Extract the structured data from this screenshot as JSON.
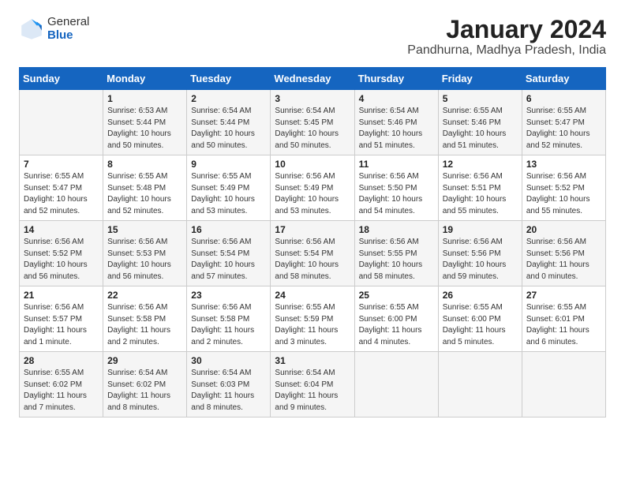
{
  "logo": {
    "general": "General",
    "blue": "Blue"
  },
  "title": "January 2024",
  "location": "Pandhurna, Madhya Pradesh, India",
  "days_header": [
    "Sunday",
    "Monday",
    "Tuesday",
    "Wednesday",
    "Thursday",
    "Friday",
    "Saturday"
  ],
  "weeks": [
    [
      {
        "day": "",
        "info": ""
      },
      {
        "day": "1",
        "info": "Sunrise: 6:53 AM\nSunset: 5:44 PM\nDaylight: 10 hours\nand 50 minutes."
      },
      {
        "day": "2",
        "info": "Sunrise: 6:54 AM\nSunset: 5:44 PM\nDaylight: 10 hours\nand 50 minutes."
      },
      {
        "day": "3",
        "info": "Sunrise: 6:54 AM\nSunset: 5:45 PM\nDaylight: 10 hours\nand 50 minutes."
      },
      {
        "day": "4",
        "info": "Sunrise: 6:54 AM\nSunset: 5:46 PM\nDaylight: 10 hours\nand 51 minutes."
      },
      {
        "day": "5",
        "info": "Sunrise: 6:55 AM\nSunset: 5:46 PM\nDaylight: 10 hours\nand 51 minutes."
      },
      {
        "day": "6",
        "info": "Sunrise: 6:55 AM\nSunset: 5:47 PM\nDaylight: 10 hours\nand 52 minutes."
      }
    ],
    [
      {
        "day": "7",
        "info": "Sunrise: 6:55 AM\nSunset: 5:47 PM\nDaylight: 10 hours\nand 52 minutes."
      },
      {
        "day": "8",
        "info": "Sunrise: 6:55 AM\nSunset: 5:48 PM\nDaylight: 10 hours\nand 52 minutes."
      },
      {
        "day": "9",
        "info": "Sunrise: 6:55 AM\nSunset: 5:49 PM\nDaylight: 10 hours\nand 53 minutes."
      },
      {
        "day": "10",
        "info": "Sunrise: 6:56 AM\nSunset: 5:49 PM\nDaylight: 10 hours\nand 53 minutes."
      },
      {
        "day": "11",
        "info": "Sunrise: 6:56 AM\nSunset: 5:50 PM\nDaylight: 10 hours\nand 54 minutes."
      },
      {
        "day": "12",
        "info": "Sunrise: 6:56 AM\nSunset: 5:51 PM\nDaylight: 10 hours\nand 55 minutes."
      },
      {
        "day": "13",
        "info": "Sunrise: 6:56 AM\nSunset: 5:52 PM\nDaylight: 10 hours\nand 55 minutes."
      }
    ],
    [
      {
        "day": "14",
        "info": "Sunrise: 6:56 AM\nSunset: 5:52 PM\nDaylight: 10 hours\nand 56 minutes."
      },
      {
        "day": "15",
        "info": "Sunrise: 6:56 AM\nSunset: 5:53 PM\nDaylight: 10 hours\nand 56 minutes."
      },
      {
        "day": "16",
        "info": "Sunrise: 6:56 AM\nSunset: 5:54 PM\nDaylight: 10 hours\nand 57 minutes."
      },
      {
        "day": "17",
        "info": "Sunrise: 6:56 AM\nSunset: 5:54 PM\nDaylight: 10 hours\nand 58 minutes."
      },
      {
        "day": "18",
        "info": "Sunrise: 6:56 AM\nSunset: 5:55 PM\nDaylight: 10 hours\nand 58 minutes."
      },
      {
        "day": "19",
        "info": "Sunrise: 6:56 AM\nSunset: 5:56 PM\nDaylight: 10 hours\nand 59 minutes."
      },
      {
        "day": "20",
        "info": "Sunrise: 6:56 AM\nSunset: 5:56 PM\nDaylight: 11 hours\nand 0 minutes."
      }
    ],
    [
      {
        "day": "21",
        "info": "Sunrise: 6:56 AM\nSunset: 5:57 PM\nDaylight: 11 hours\nand 1 minute."
      },
      {
        "day": "22",
        "info": "Sunrise: 6:56 AM\nSunset: 5:58 PM\nDaylight: 11 hours\nand 2 minutes."
      },
      {
        "day": "23",
        "info": "Sunrise: 6:56 AM\nSunset: 5:58 PM\nDaylight: 11 hours\nand 2 minutes."
      },
      {
        "day": "24",
        "info": "Sunrise: 6:55 AM\nSunset: 5:59 PM\nDaylight: 11 hours\nand 3 minutes."
      },
      {
        "day": "25",
        "info": "Sunrise: 6:55 AM\nSunset: 6:00 PM\nDaylight: 11 hours\nand 4 minutes."
      },
      {
        "day": "26",
        "info": "Sunrise: 6:55 AM\nSunset: 6:00 PM\nDaylight: 11 hours\nand 5 minutes."
      },
      {
        "day": "27",
        "info": "Sunrise: 6:55 AM\nSunset: 6:01 PM\nDaylight: 11 hours\nand 6 minutes."
      }
    ],
    [
      {
        "day": "28",
        "info": "Sunrise: 6:55 AM\nSunset: 6:02 PM\nDaylight: 11 hours\nand 7 minutes."
      },
      {
        "day": "29",
        "info": "Sunrise: 6:54 AM\nSunset: 6:02 PM\nDaylight: 11 hours\nand 8 minutes."
      },
      {
        "day": "30",
        "info": "Sunrise: 6:54 AM\nSunset: 6:03 PM\nDaylight: 11 hours\nand 8 minutes."
      },
      {
        "day": "31",
        "info": "Sunrise: 6:54 AM\nSunset: 6:04 PM\nDaylight: 11 hours\nand 9 minutes."
      },
      {
        "day": "",
        "info": ""
      },
      {
        "day": "",
        "info": ""
      },
      {
        "day": "",
        "info": ""
      }
    ]
  ]
}
